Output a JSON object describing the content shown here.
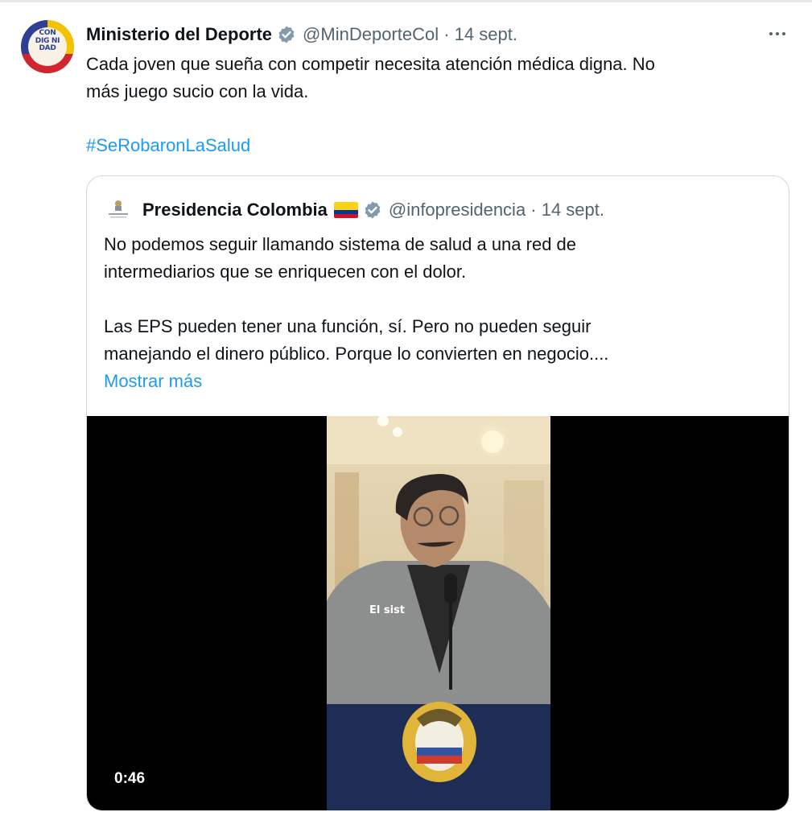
{
  "tweet": {
    "author_name": "Ministerio del Deporte",
    "handle_date": "@MinDeporteCol · 14 sept.",
    "avatar_text": "CON DIG NI DAD",
    "text_lines": [
      "Cada joven que sueña con competir necesita atención médica digna. No",
      "más juego sucio con la vida."
    ],
    "hashtag": "#SeRobaronLaSalud",
    "more_icon": "more-dots-icon",
    "verified_icon": "verified-badge-icon"
  },
  "quoted": {
    "author_name": "Presidencia Colombia",
    "flag_icon": "colombia-flag-icon",
    "handle_date": "@infopresidencia · 14 sept.",
    "paragraph1": [
      "No podemos seguir llamando sistema de salud a una red de",
      "intermediarios que se enriquecen con el dolor."
    ],
    "paragraph2": [
      "Las EPS pueden tener una función, sí. Pero no pueden seguir",
      "manejando el dinero público. Porque lo convierten en negocio...."
    ],
    "show_more": "Mostrar más",
    "video": {
      "duration": "0:46",
      "caption": "El sist"
    }
  },
  "colors": {
    "link": "#1d9bf0",
    "text": "#0f1419",
    "secondary": "#536471",
    "border": "#cfd9de",
    "verified": "#829aab"
  }
}
